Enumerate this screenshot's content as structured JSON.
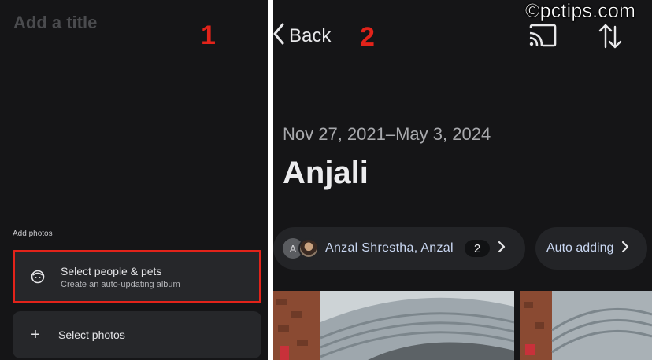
{
  "left_panel": {
    "title_placeholder": "Add a title",
    "step_label": "1",
    "add_photos_label": "Add photos",
    "options": {
      "people": {
        "title": "Select people & pets",
        "subtitle": "Create an auto-updating album",
        "icon": "face-icon"
      },
      "photos": {
        "title": "Select photos",
        "icon": "plus-icon"
      }
    }
  },
  "right_panel": {
    "back_label": "Back",
    "step_label": "2",
    "watermark": "©pctips.com",
    "date_range": "Nov 27, 2021–May 3, 2024",
    "album_name": "Anjali",
    "people_chip": {
      "avatar_letter": "A",
      "label": "Anzal Shrestha, Anzal",
      "count": "2"
    },
    "auto_chip": {
      "label": "Auto adding"
    },
    "toolbar_icons": [
      "cast-icon",
      "sort-icon"
    ]
  },
  "colors": {
    "background": "#151517",
    "highlight": "#e2231a",
    "chip_text": "#c9d7f2"
  }
}
